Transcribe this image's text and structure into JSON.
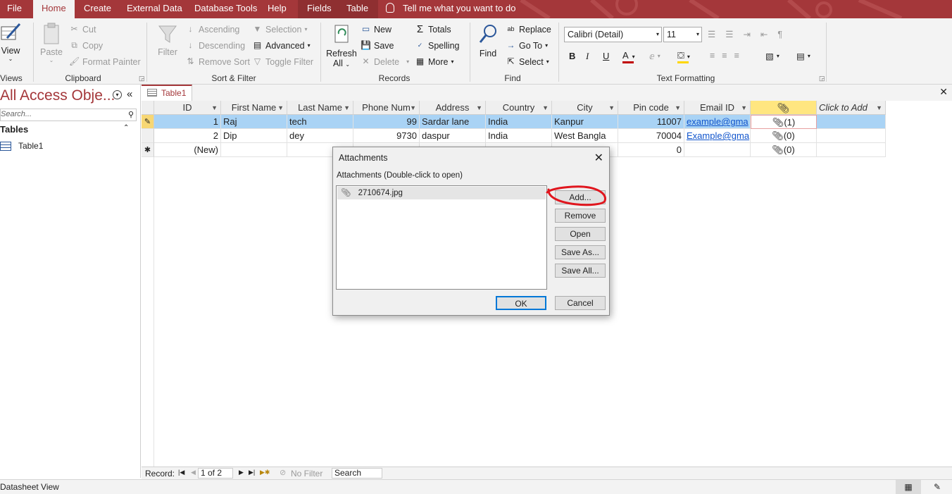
{
  "tabs": {
    "file": "File",
    "home": "Home",
    "create": "Create",
    "external": "External Data",
    "dbtools": "Database Tools",
    "help": "Help",
    "fields": "Fields",
    "table": "Table",
    "tellme": "Tell me what you want to do"
  },
  "ribbon": {
    "views": {
      "view": "View",
      "label": "Views"
    },
    "clipboard": {
      "paste": "Paste",
      "cut": "Cut",
      "copy": "Copy",
      "format_painter": "Format Painter",
      "label": "Clipboard"
    },
    "sort": {
      "filter": "Filter",
      "ascending": "Ascending",
      "descending": "Descending",
      "remove_sort": "Remove Sort",
      "selection": "Selection",
      "advanced": "Advanced",
      "toggle_filter": "Toggle Filter",
      "label": "Sort & Filter"
    },
    "records": {
      "refresh": "Refresh",
      "all": "All",
      "new": "New",
      "save": "Save",
      "delete": "Delete",
      "totals": "Totals",
      "spelling": "Spelling",
      "more": "More",
      "label": "Records"
    },
    "find": {
      "find": "Find",
      "replace": "Replace",
      "goto": "Go To",
      "select": "Select",
      "label": "Find"
    },
    "text": {
      "font": "Calibri (Detail)",
      "size": "11",
      "bold": "B",
      "italic": "I",
      "underline": "U",
      "label": "Text Formatting",
      "font_color": "#c00000",
      "highlight_color": "#ffd700"
    }
  },
  "nav": {
    "title": "All Access Obje...",
    "search_placeholder": "Search...",
    "section": "Tables",
    "items": [
      {
        "label": "Table1"
      }
    ]
  },
  "doc_tab": "Table1",
  "table": {
    "columns": [
      "ID",
      "First Name",
      "Last Name",
      "Phone Num",
      "Address",
      "Country",
      "City",
      "Pin code",
      "Email ID",
      "",
      "Click to Add"
    ],
    "rows": [
      {
        "id": "1",
        "first": "Raj",
        "last": "tech",
        "phone": "99",
        "address": "Sardar lane",
        "country": "India",
        "city": "Kanpur",
        "pin": "11007",
        "email": "example@gma",
        "attach": "(1)"
      },
      {
        "id": "2",
        "first": "Dip",
        "last": "dey",
        "phone": "9730",
        "address": "daspur",
        "country": "India",
        "city": "West Bangla",
        "pin": "70004",
        "email": "Example@gma",
        "attach": "(0)"
      }
    ],
    "new_row": {
      "id": "(New)",
      "pin": "0",
      "attach": "(0)"
    }
  },
  "record_bar": {
    "label": "Record:",
    "position": "1 of 2",
    "no_filter": "No Filter",
    "search": "Search"
  },
  "status": {
    "view": "Datasheet View"
  },
  "dialog": {
    "title": "Attachments",
    "list_label": "Attachments (Double-click to open)",
    "files": [
      "2710674.jpg"
    ],
    "buttons": {
      "add": "Add...",
      "remove": "Remove",
      "open": "Open",
      "save_as": "Save As...",
      "save_all": "Save All...",
      "ok": "OK",
      "cancel": "Cancel"
    }
  },
  "colors": {
    "brand": "#a4373a",
    "selected_row": "#a9d3f5",
    "header_highlight": "#ffe680",
    "annotation": "#e0161e"
  }
}
